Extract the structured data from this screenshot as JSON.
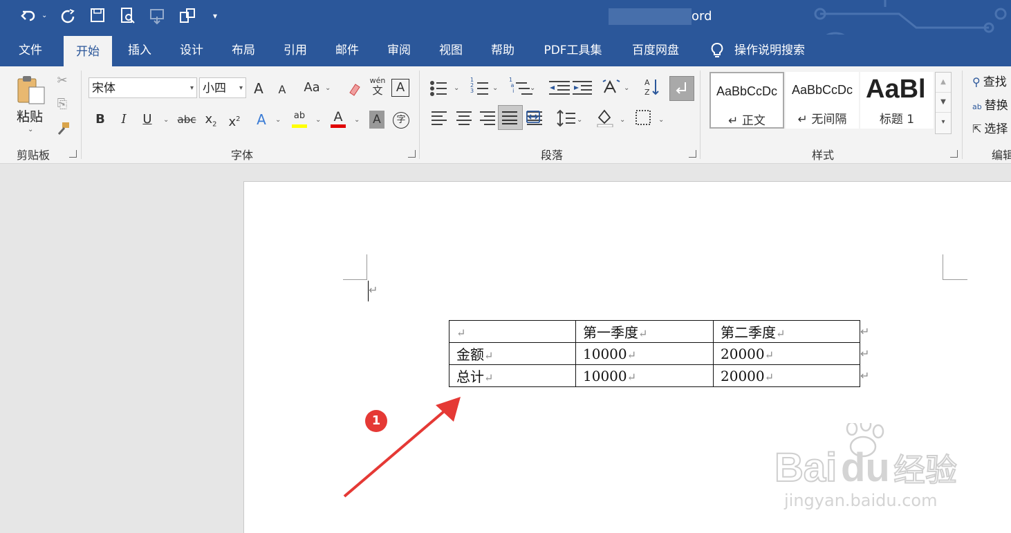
{
  "titlebar": {
    "title_visible": "ord",
    "qat_icons": [
      "undo-icon",
      "dropdown-icon",
      "redo-icon",
      "save-icon",
      "print-preview-icon",
      "touch-mode-icon",
      "format-icon",
      "customize-icon"
    ]
  },
  "tabs": [
    {
      "label": "文件"
    },
    {
      "label": "开始"
    },
    {
      "label": "插入"
    },
    {
      "label": "设计"
    },
    {
      "label": "布局"
    },
    {
      "label": "引用"
    },
    {
      "label": "邮件"
    },
    {
      "label": "审阅"
    },
    {
      "label": "视图"
    },
    {
      "label": "帮助"
    },
    {
      "label": "PDF工具集"
    },
    {
      "label": "百度网盘"
    }
  ],
  "tell_me": {
    "label": "操作说明搜索"
  },
  "ribbon": {
    "clipboard": {
      "paste_label": "粘贴",
      "group_label": "剪贴板"
    },
    "font": {
      "font_name": "宋体",
      "font_size": "小四",
      "change_case": "Aa",
      "group_label": "字体",
      "bold": "B",
      "italic": "I",
      "underline": "U",
      "strike": "abc",
      "subscript": "x",
      "superscript": "x",
      "sub_mark": "2",
      "sup_mark": "2",
      "phonetic_top": "wén",
      "phonetic_bottom": "文",
      "char_border": "A",
      "grow": "A",
      "shrink": "A",
      "effects": "A",
      "font_color": "A",
      "shading": "A",
      "enclose": "字",
      "highlight": "ab"
    },
    "paragraph": {
      "group_label": "段落"
    },
    "styles": {
      "group_label": "样式",
      "items": [
        {
          "sample": "AaBbCcDc",
          "name": "↵ 正文"
        },
        {
          "sample": "AaBbCcDc",
          "name": "↵ 无间隔"
        },
        {
          "sample": "AaBl",
          "name": "标题 1"
        }
      ]
    },
    "editing": {
      "find": "查找",
      "replace": "替换",
      "select": "选择",
      "group_label": "编辑"
    }
  },
  "document": {
    "table": {
      "rows": [
        [
          "",
          "第一季度",
          "第二季度"
        ],
        [
          "金额",
          "10000",
          "20000"
        ],
        [
          "总计",
          "10000",
          "20000"
        ]
      ]
    },
    "paragraph_mark": "↵",
    "badge": "1"
  },
  "watermark": {
    "brand": "Baidu经验",
    "url": "jingyan.baidu.com"
  },
  "colors": {
    "accent": "#2b579a",
    "ribbon_bg": "#f3f3f3",
    "badge": "#e53935"
  }
}
